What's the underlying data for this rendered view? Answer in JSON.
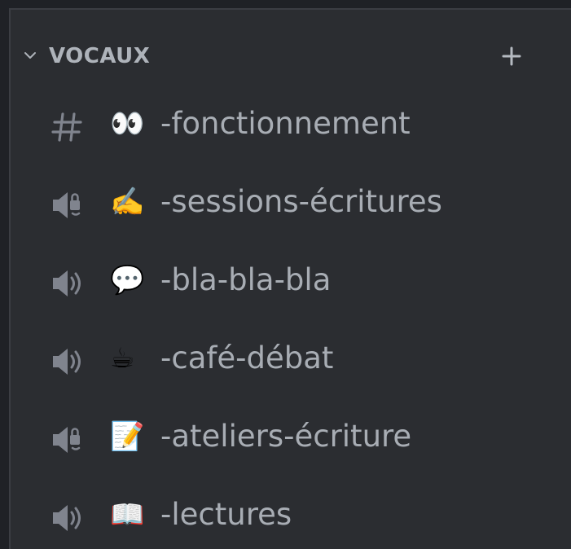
{
  "category": {
    "label": "VOCAUX",
    "collapse_icon": "chevron-down-icon",
    "add_icon": "plus-icon"
  },
  "channels": [
    {
      "icon": "hashtag-icon",
      "emoji": "👀",
      "name": "-fonctionnement"
    },
    {
      "icon": "speaker-lock-icon",
      "emoji": "✍️",
      "name": "-sessions-écritures"
    },
    {
      "icon": "speaker-icon",
      "emoji": "💬",
      "name": "-bla-bla-bla"
    },
    {
      "icon": "speaker-icon",
      "emoji": "☕",
      "name": "-café-débat"
    },
    {
      "icon": "speaker-lock-icon",
      "emoji": "📝",
      "name": "-ateliers-écriture"
    },
    {
      "icon": "speaker-icon",
      "emoji": "📖",
      "name": "-lectures"
    }
  ],
  "colors": {
    "background": "#2b2d31",
    "text": "#a8adb4",
    "icon": "#80848e"
  }
}
